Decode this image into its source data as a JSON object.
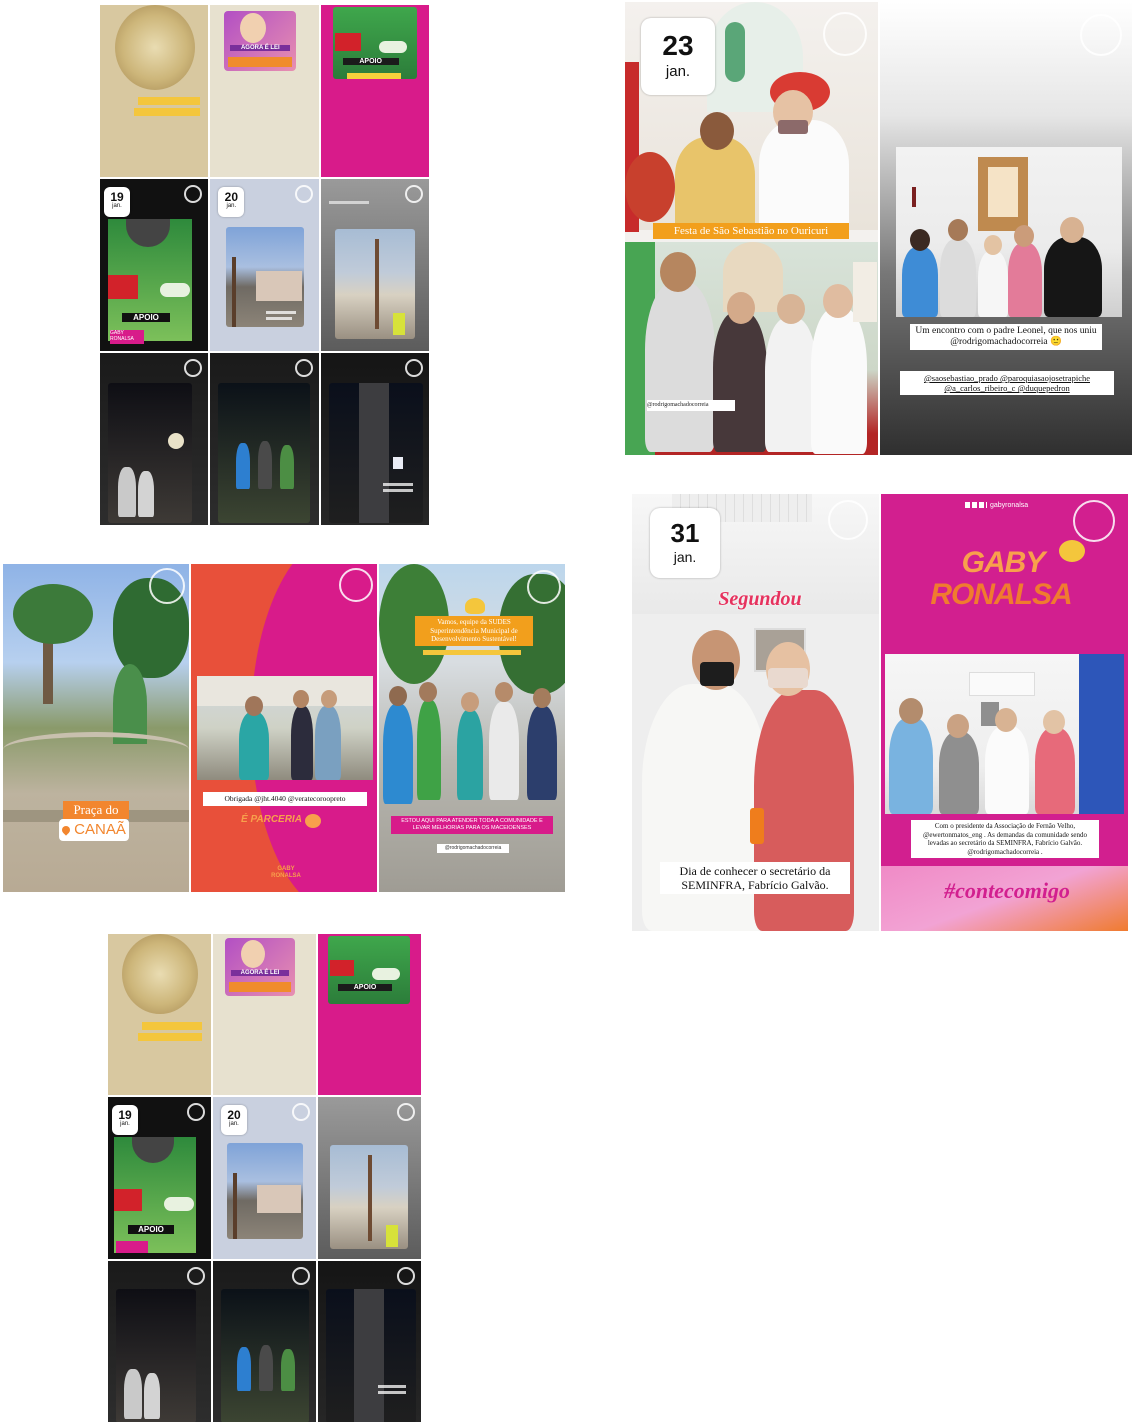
{
  "collage_a": {
    "tile_1": {
      "caption_hint": ""
    },
    "tile_2": {
      "label": "AGORA É LEI"
    },
    "tile_3": {
      "label": "APOIO"
    },
    "tile_4": {
      "date_day": "19",
      "date_month": "jan.",
      "label": "APOIO",
      "brand": "GABY RONALSA"
    },
    "tile_5": {
      "date_day": "20",
      "date_month": "jan."
    }
  },
  "collage_b": {
    "tile_1": {
      "label": "AGORA É LEI"
    },
    "tile_3": {
      "label": "APOIO"
    },
    "tile_4": {
      "date_day": "19",
      "date_month": "jan.",
      "label": "APOIO"
    },
    "tile_5": {
      "date_day": "20",
      "date_month": "jan."
    }
  },
  "story_23": {
    "date_day": "23",
    "date_month": "jan.",
    "festa_caption": "Festa de São Sebastião no Ouricuri",
    "tag_left": "@rodrigomachadocorreia",
    "encontro_caption": "Um encontro com o padre Leonel, que nos uniu @rodrigomachadocorreia 🙂",
    "tags_caption": "@saosebastiao_prado @paroquiasaojosetrapiche @a_carlos_ribeiro_c @duquepedron"
  },
  "story_31": {
    "date_day": "31",
    "date_month": "jan.",
    "sign": "Segundou",
    "caption": "Dia de conhecer o secretário da SEMINFRA, Fabrício Galvão.",
    "handle": "gabyronalsa",
    "brand_line_1": "GABY",
    "brand_line_2": "RONALSA",
    "assoc_caption": "Com o presidente da Associação de Fernão Velho, @ewertonmatos_eng . As demandas da comunidade sendo levadas ao secretário da SEMINFRA, Fabrício Galvão. @rodrigomachadocorreia .",
    "hashtag": "#contecomigo"
  },
  "story_praca": {
    "praca_line_1": "Praça do",
    "praca_line_2": "CANAÃ",
    "obrigada": "Obrigada @jht.4040 @veratecoroopreto",
    "parceria": "É PARCERIA",
    "sudes_caption": "Vamos, equipe da SUDES Superintendência Municipal de Desenvolvimento Sustentável!",
    "estou_aqui": "ESTOU AQUI PARA ATENDER TODA A COMUNIDADE E LEVAR MELHORIAS PARA OS MACEIOENSES",
    "handle_small": "@rodrigomachadocorreia",
    "brand": "GABY RONALSA"
  },
  "colors": {
    "magenta": "#d81b8a",
    "orange": "#f06a2c",
    "dark": "#141414",
    "badge": "#ffffff"
  }
}
